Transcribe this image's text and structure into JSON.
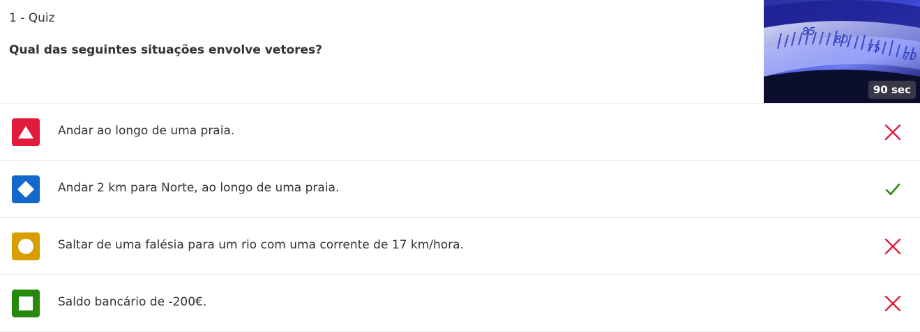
{
  "quiz": {
    "label": "1 - Quiz",
    "question": "Qual das seguintes situações envolve vetores?",
    "timer": "90 sec",
    "thumbnail_scale_numbers": [
      "85",
      "80",
      "75",
      "70"
    ]
  },
  "options": [
    {
      "text": "Andar ao longo de uma praia.",
      "shape": "triangle-icon",
      "color": "#e21b3c",
      "result": "incorrect"
    },
    {
      "text": "Andar 2 km para Norte, ao longo de uma praia.",
      "shape": "diamond-icon",
      "color": "#1368ce",
      "result": "correct"
    },
    {
      "text": "Saltar de uma falésia para um rio com uma corrente de 17 km/hora.",
      "shape": "circle-icon",
      "color": "#d89e00",
      "result": "incorrect"
    },
    {
      "text": "Saldo bancário de -200€.",
      "shape": "square-icon",
      "color": "#26890c",
      "result": "incorrect"
    }
  ],
  "colors": {
    "incorrect": "#e21b3c",
    "correct": "#26890c"
  }
}
